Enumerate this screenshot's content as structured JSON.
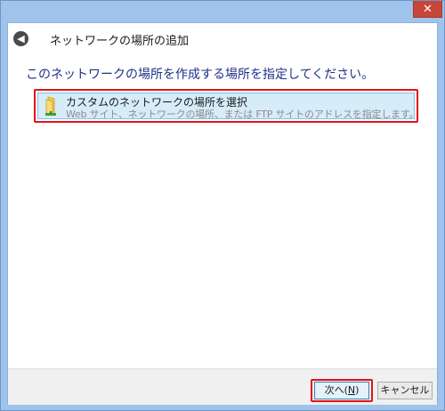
{
  "window": {
    "close_glyph": "✕"
  },
  "header": {
    "back_glyph": "◀",
    "title": "ネットワークの場所の追加"
  },
  "main": {
    "instruction": "このネットワークの場所を作成する場所を指定してください。",
    "option": {
      "icon": "network-folder-icon",
      "title": "カスタムのネットワークの場所を選択",
      "description": "Web サイト、ネットワークの場所、または FTP サイトのアドレスを指定します。"
    }
  },
  "footer": {
    "next_label": "次へ(",
    "next_mnemonic": "N",
    "next_suffix": ")",
    "cancel_label": "キャンセル"
  },
  "colors": {
    "highlight_border": "#e0141b",
    "selection_bg": "#d6ecf9",
    "title_bar": "#9fc3ea",
    "instruction_text": "#1e3287"
  }
}
